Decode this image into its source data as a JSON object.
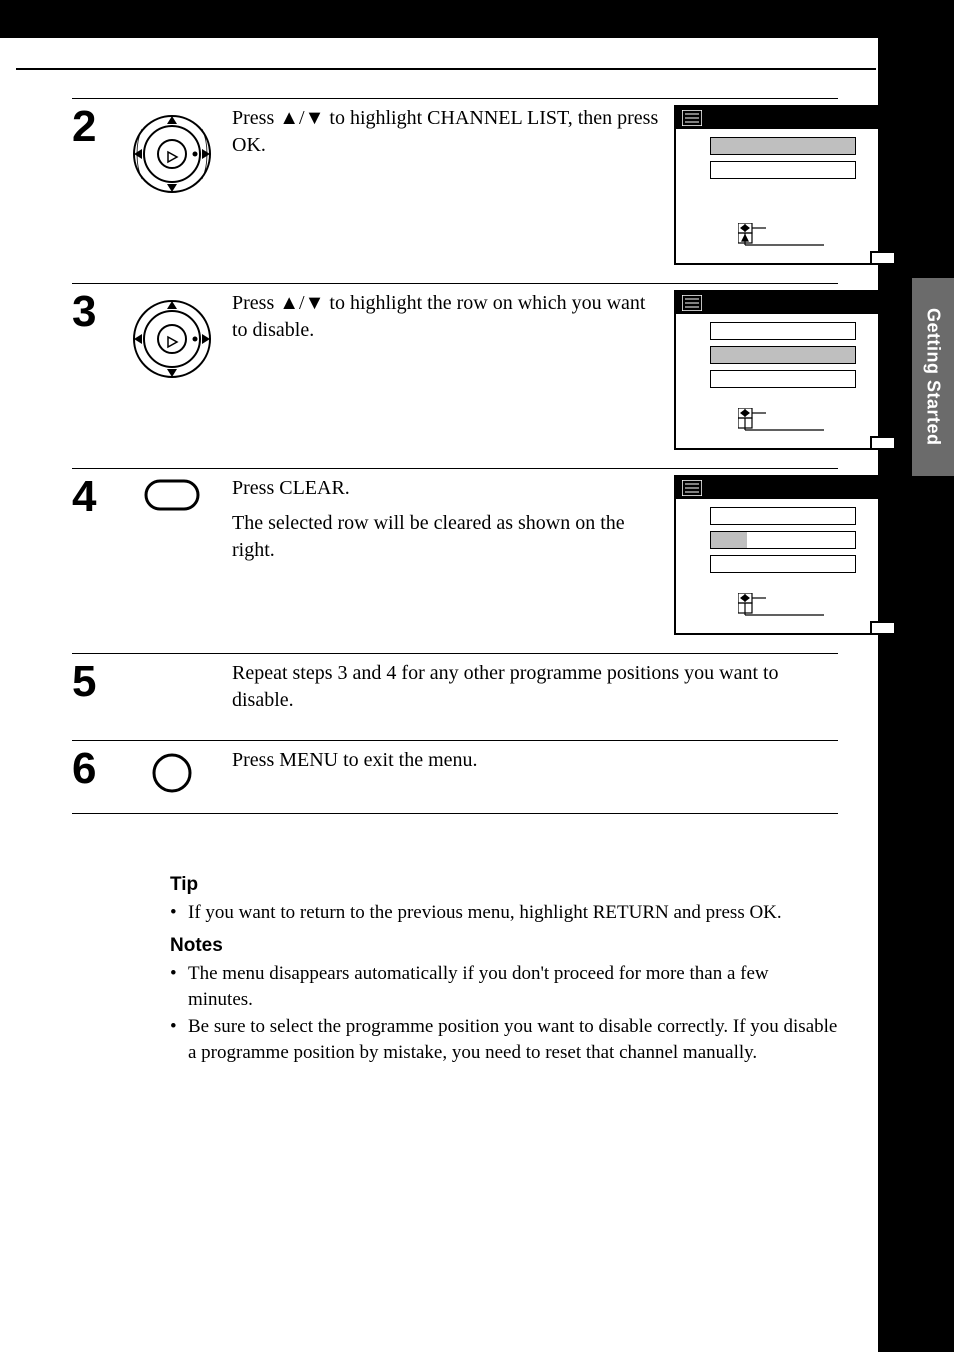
{
  "sideTab": "Getting Started",
  "steps": [
    {
      "num": "2",
      "text_pre": "Press ",
      "text_post": " to highlight CHANNEL LIST, then press OK.",
      "hasDial": true,
      "hasScreen": true,
      "screen_rows": [
        "sel",
        "plain"
      ]
    },
    {
      "num": "3",
      "text_pre": "Press ",
      "text_post": " to highlight the row on which you want to disable.",
      "hasDial": true,
      "hasScreen": true,
      "screen_rows": [
        "plain",
        "sel",
        "plain"
      ]
    },
    {
      "num": "4",
      "text1": "Press CLEAR.",
      "text2": "The selected row will be cleared as shown on the right.",
      "hasPill": true,
      "hasScreen": true,
      "screen_rows": [
        "plain",
        "halfsel",
        "plain"
      ]
    },
    {
      "num": "5",
      "text": "Repeat steps 3 and 4 for any other programme positions you want to disable.",
      "hasScreen": false
    },
    {
      "num": "6",
      "text": "Press MENU to exit the menu.",
      "hasCircle": true,
      "hasScreen": false
    }
  ],
  "tipHead": "Tip",
  "tipItems": [
    "If you want to return to the previous menu, highlight RETURN and press OK."
  ],
  "notesHead": "Notes",
  "notesItems": [
    "The menu disappears automatically if you don't proceed for more than a few minutes.",
    "Be sure to select the programme position you want to disable correctly.  If you disable a programme position by mistake, you need to reset that channel manually."
  ],
  "arrows": "↑/↓"
}
